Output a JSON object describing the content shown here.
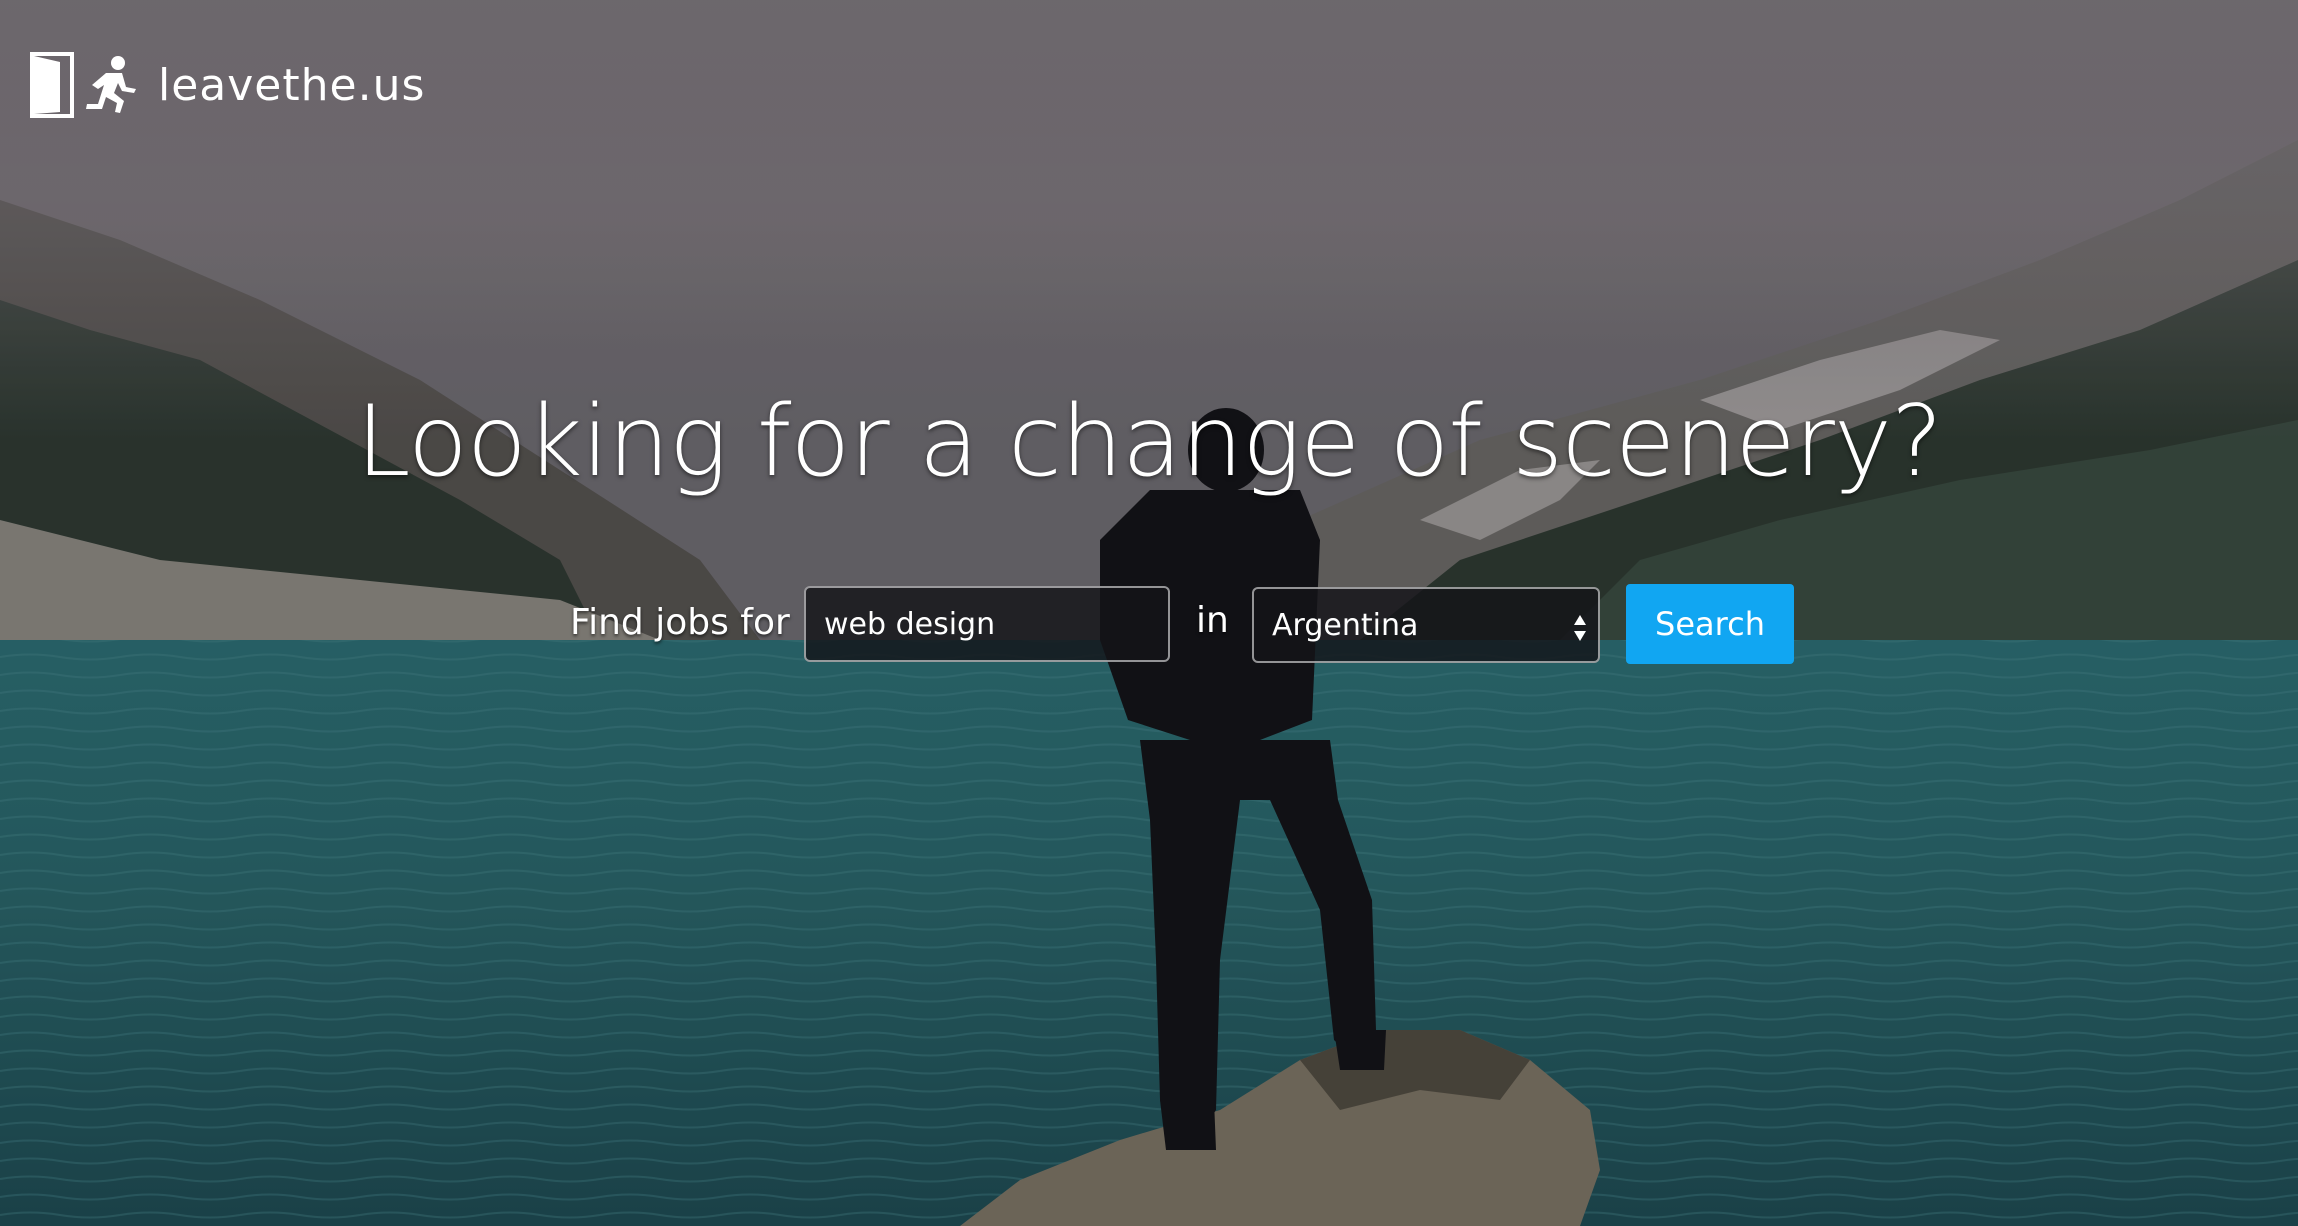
{
  "brand": {
    "name": "leavethe.us",
    "door_icon": "door-icon",
    "runner_icon": "running-person-icon"
  },
  "hero": {
    "headline": "Looking for a change of scenery?"
  },
  "search": {
    "find_label": "Find jobs for",
    "keyword_value": "web design",
    "in_label": "in",
    "country_value": "Argentina",
    "button_label": "Search"
  },
  "colors": {
    "accent": "#11a6f2",
    "lake": "#2a6a70",
    "sky": "#7a7479"
  }
}
